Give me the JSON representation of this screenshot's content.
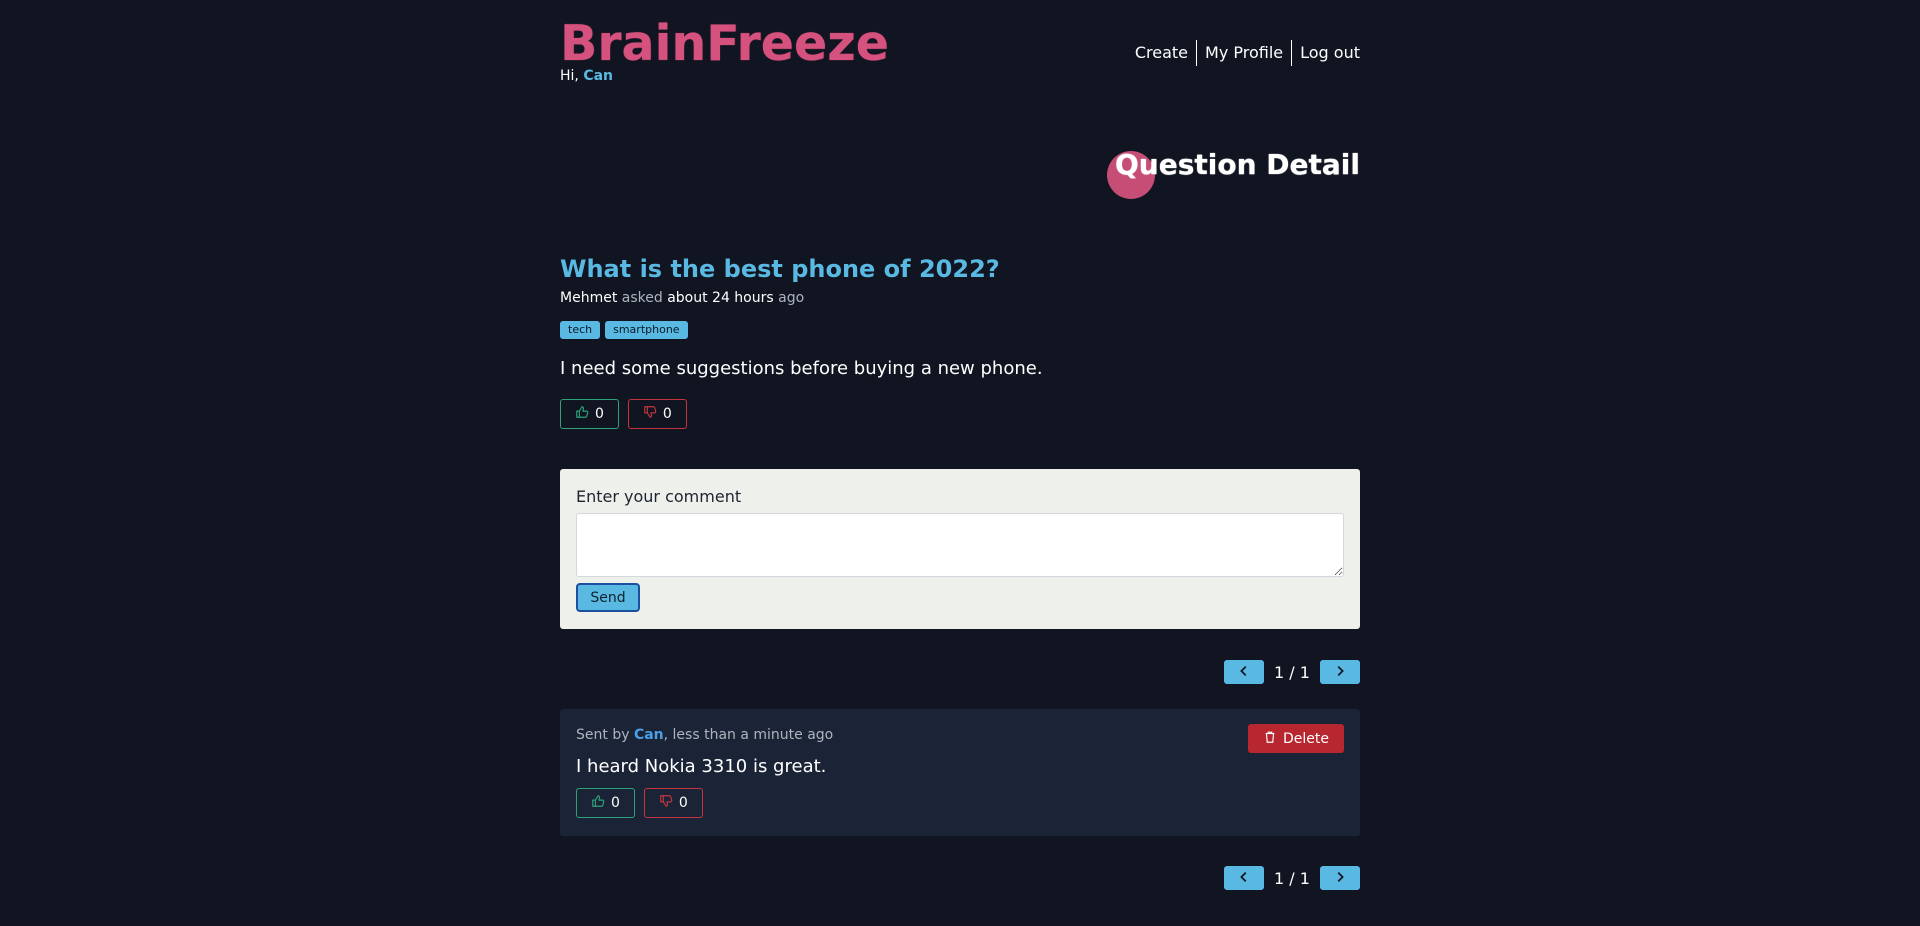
{
  "header": {
    "brand": "BrainFreeze",
    "greeting_prefix": "Hi,",
    "username": "Can",
    "nav": [
      "Create",
      "My Profile",
      "Log out"
    ]
  },
  "page_heading": "Question Detail",
  "question": {
    "title": "What is the best phone of 2022?",
    "author": "Mehmet",
    "asked_word": "asked",
    "time": "about 24 hours",
    "ago_word": "ago",
    "tags": [
      "tech",
      "smartphone"
    ],
    "body": "I need some suggestions before buying a new phone.",
    "likes": "0",
    "dislikes": "0"
  },
  "comment_form": {
    "label": "Enter your comment",
    "value": "",
    "send_label": "Send"
  },
  "pagination": {
    "top": "1 / 1",
    "bottom": "1 / 1"
  },
  "comments": [
    {
      "sent_by_prefix": "Sent by",
      "author": "Can",
      "time_suffix": ", less than a minute ago",
      "text": "I heard Nokia 3310 is great.",
      "delete_label": "Delete",
      "likes": "0",
      "dislikes": "0"
    }
  ],
  "colors": {
    "background": "#101521",
    "brand": "#d6527e",
    "accent": "#5ab9e3",
    "like": "#2ea37a",
    "dislike": "#c5353f",
    "delete": "#b8262f"
  },
  "icons": [
    "thumbs-up-icon",
    "thumbs-down-icon",
    "chevron-left-icon",
    "chevron-right-icon",
    "trash-icon"
  ]
}
